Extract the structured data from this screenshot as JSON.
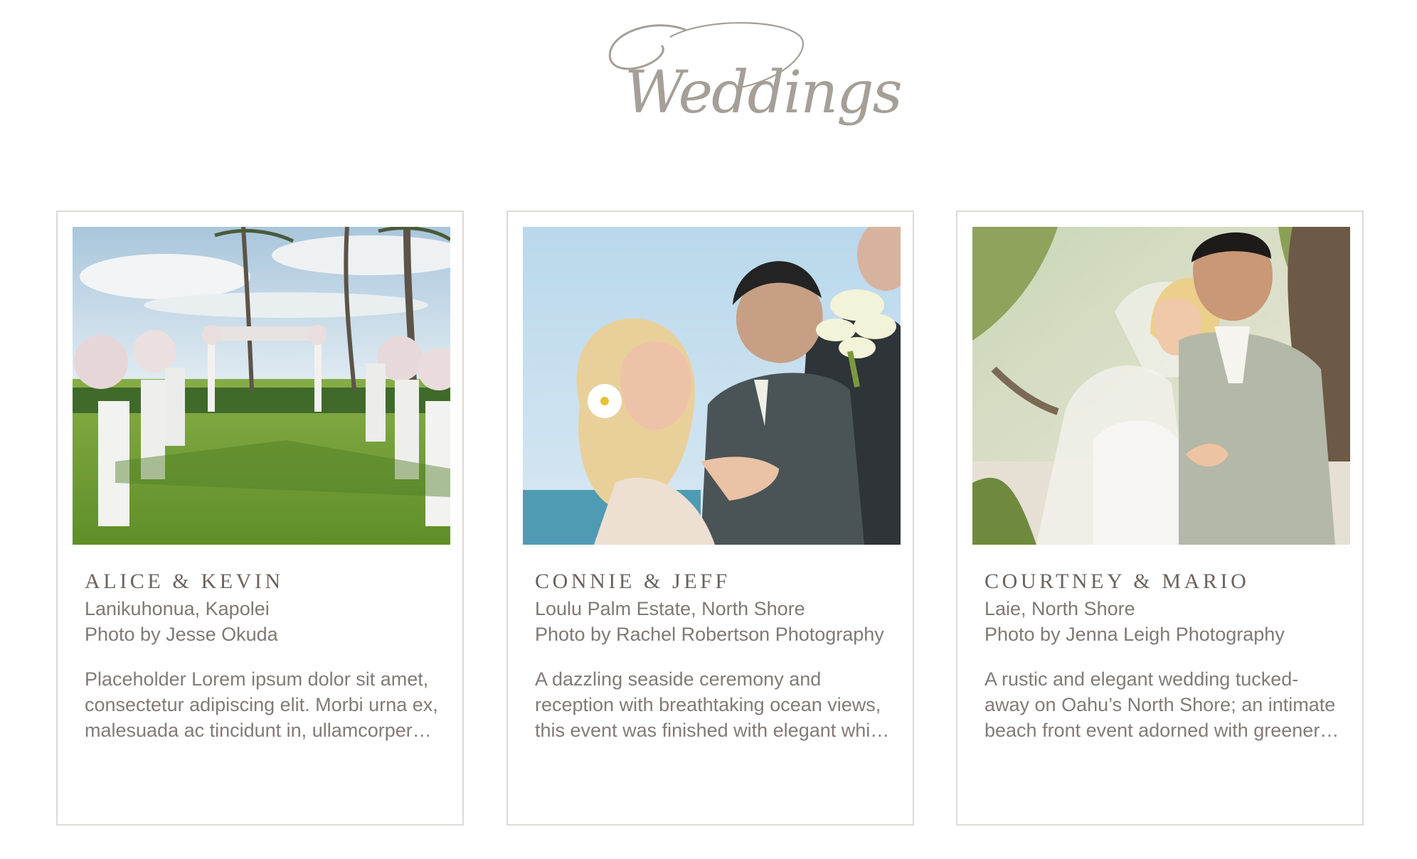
{
  "page": {
    "title": "Weddings",
    "title_color": "#a59f98"
  },
  "weddings": [
    {
      "couple": "ALICE & KEVIN",
      "venue": "Lanikuhonua, Kapolei",
      "photo_credit": "Photo by Jesse Okuda",
      "description": "Placeholder Lorem ipsum dolor sit amet, consectetur adipiscing elit. Morbi urna ex, malesuada ac tincidunt in, ullamcorper vitae lorem."
    },
    {
      "couple": "CONNIE & JEFF",
      "venue": "Loulu Palm Estate, North Shore",
      "photo_credit": "Photo by Rachel Robertson Photography",
      "description": "A dazzling seaside ceremony and reception with breathtaking ocean views, this event was finished with elegant white florals and soft candlelight."
    },
    {
      "couple": "COURTNEY & MARIO",
      "venue": "Laie, North Shore",
      "photo_credit": "Photo by Jenna Leigh Photography",
      "description": "A rustic and elegant wedding tucked-away on Oahu’s North Shore; an intimate beach front event adorned with greenery and natural textures."
    }
  ],
  "colors": {
    "card_border": "#dddad7",
    "title_text": "#6b625d",
    "body_text": "#7f7974"
  }
}
